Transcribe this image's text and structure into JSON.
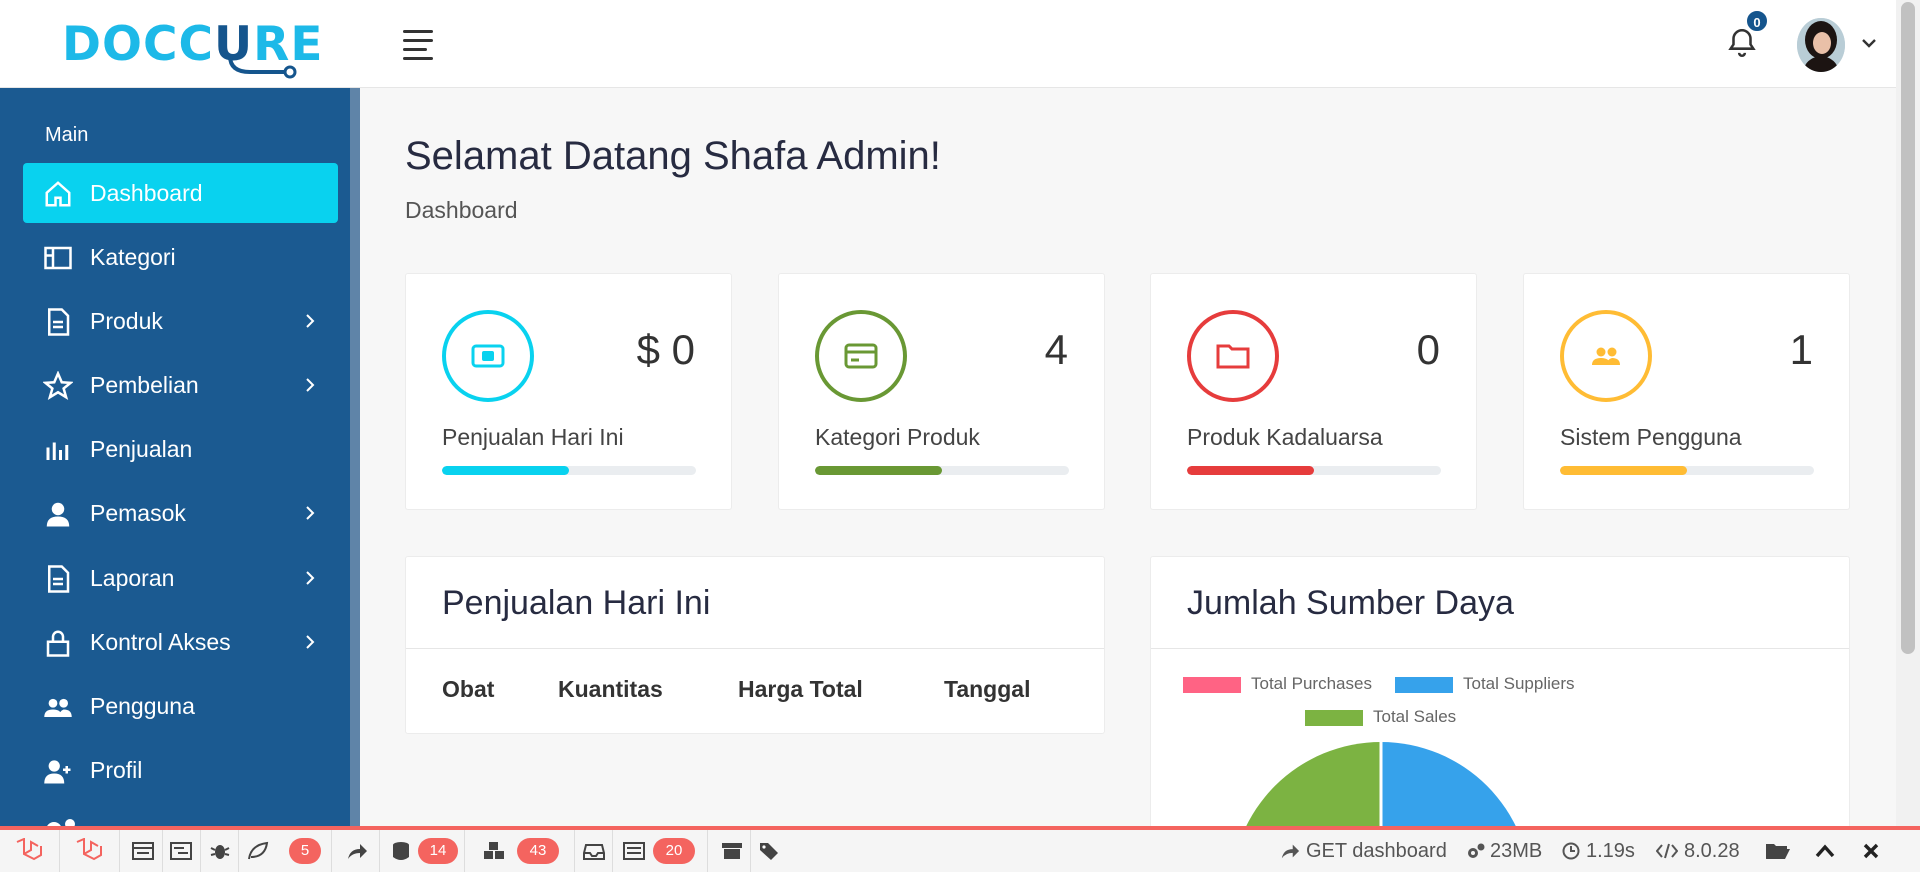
{
  "brand": {
    "name_part1": "DOCC",
    "name_part2": "U",
    "name_part3": "RE"
  },
  "header": {
    "notification_count": "0"
  },
  "sidebar": {
    "section_title": "Main",
    "items": [
      {
        "label": "Dashboard",
        "icon": "home-icon",
        "has_submenu": false,
        "active": true
      },
      {
        "label": "Kategori",
        "icon": "layout-icon",
        "has_submenu": false,
        "active": false
      },
      {
        "label": "Produk",
        "icon": "document-icon",
        "has_submenu": true,
        "active": false
      },
      {
        "label": "Pembelian",
        "icon": "star-icon",
        "has_submenu": true,
        "active": false
      },
      {
        "label": "Penjualan",
        "icon": "bar-chart-icon",
        "has_submenu": false,
        "active": false
      },
      {
        "label": "Pemasok",
        "icon": "user-icon",
        "has_submenu": true,
        "active": false
      },
      {
        "label": "Laporan",
        "icon": "document-icon",
        "has_submenu": true,
        "active": false
      },
      {
        "label": "Kontrol Akses",
        "icon": "lock-icon",
        "has_submenu": true,
        "active": false
      },
      {
        "label": "Pengguna",
        "icon": "users-icon",
        "has_submenu": false,
        "active": false
      },
      {
        "label": "Profil",
        "icon": "user-add-icon",
        "has_submenu": false,
        "active": false
      }
    ]
  },
  "page": {
    "title": "Selamat Datang Shafa Admin!",
    "breadcrumb": "Dashboard"
  },
  "stats": [
    {
      "value": "$ 0",
      "label": "Penjualan Hari Ini",
      "color": "#09d2ef",
      "icon": "money-icon",
      "progress": 0.5
    },
    {
      "value": "4",
      "label": "Kategori Produk",
      "color": "#699834",
      "icon": "credit-card-icon",
      "progress": 0.5
    },
    {
      "value": "0",
      "label": "Produk Kadaluarsa",
      "color": "#e63c3c",
      "icon": "folder-icon",
      "progress": 0.5
    },
    {
      "value": "1",
      "label": "Sistem Pengguna",
      "color": "#ffbc34",
      "icon": "users-icon",
      "progress": 0.5
    }
  ],
  "sales_panel": {
    "title": "Penjualan Hari Ini",
    "columns": [
      "Obat",
      "Kuantitas",
      "Harga Total",
      "Tanggal"
    ]
  },
  "resources_panel": {
    "title": "Jumlah Sumber Daya",
    "legend": [
      {
        "label": "Total Purchases",
        "color": "#ff6384"
      },
      {
        "label": "Total Suppliers",
        "color": "#36a2eb"
      },
      {
        "label": "Total Sales",
        "color": "#7cb342"
      }
    ]
  },
  "debugbar": {
    "badges": [
      "5",
      "14",
      "43",
      "20"
    ],
    "route": "GET dashboard",
    "memory": "23MB",
    "time": "1.19s",
    "php_version": "8.0.28"
  }
}
